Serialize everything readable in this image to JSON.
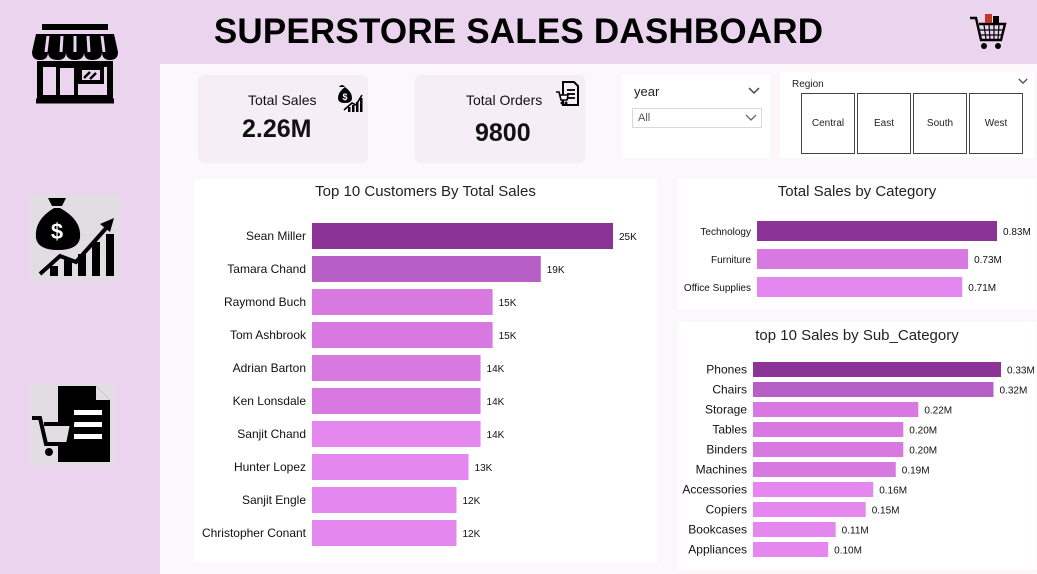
{
  "dashboard": {
    "title": "SUPERSTORE SALES DASHBOARD"
  },
  "kpis": {
    "total_sales": {
      "label": "Total Sales",
      "value": "2.26M"
    },
    "total_orders": {
      "label": "Total Orders",
      "value": "9800"
    }
  },
  "filters": {
    "year": {
      "label": "year",
      "selected": "All"
    },
    "region": {
      "label": "Region",
      "options": [
        "Central",
        "East",
        "South",
        "West"
      ]
    }
  },
  "icons": {
    "store": "store-icon",
    "money": "money-growth-icon",
    "orders": "order-document-icon",
    "cart": "shopping-cart-icon"
  },
  "colors": {
    "dark": "#8b3397",
    "mid": "#b85fc7",
    "light": "#d779e0",
    "lighter": "#e487ef"
  },
  "chart_data": [
    {
      "type": "bar",
      "title": "Top 10 Customers By Total Sales",
      "categories": [
        "Sean Miller",
        "Tamara Chand",
        "Raymond Buch",
        "Tom Ashbrook",
        "Adrian Barton",
        "Ken Lonsdale",
        "Sanjit Chand",
        "Hunter Lopez",
        "Sanjit Engle",
        "Christopher Conant"
      ],
      "values": [
        25000,
        19000,
        15000,
        15000,
        14000,
        14000,
        14000,
        13000,
        12000,
        12000
      ],
      "labels": [
        "25K",
        "19K",
        "15K",
        "15K",
        "14K",
        "14K",
        "14K",
        "13K",
        "12K",
        "12K"
      ]
    },
    {
      "type": "bar",
      "title": "Total Sales by Category",
      "categories": [
        "Technology",
        "Furniture",
        "Office Supplies"
      ],
      "values": [
        830000,
        730000,
        710000
      ],
      "labels": [
        "0.83M",
        "0.73M",
        "0.71M"
      ]
    },
    {
      "type": "bar",
      "title": "top 10 Sales by Sub_Category",
      "categories": [
        "Phones",
        "Chairs",
        "Storage",
        "Tables",
        "Binders",
        "Machines",
        "Accessories",
        "Copiers",
        "Bookcases",
        "Appliances"
      ],
      "values": [
        330000,
        320000,
        220000,
        200000,
        200000,
        190000,
        160000,
        150000,
        110000,
        100000
      ],
      "labels": [
        "0.33M",
        "0.32M",
        "0.22M",
        "0.20M",
        "0.20M",
        "0.19M",
        "0.16M",
        "0.15M",
        "0.11M",
        "0.10M"
      ]
    }
  ]
}
